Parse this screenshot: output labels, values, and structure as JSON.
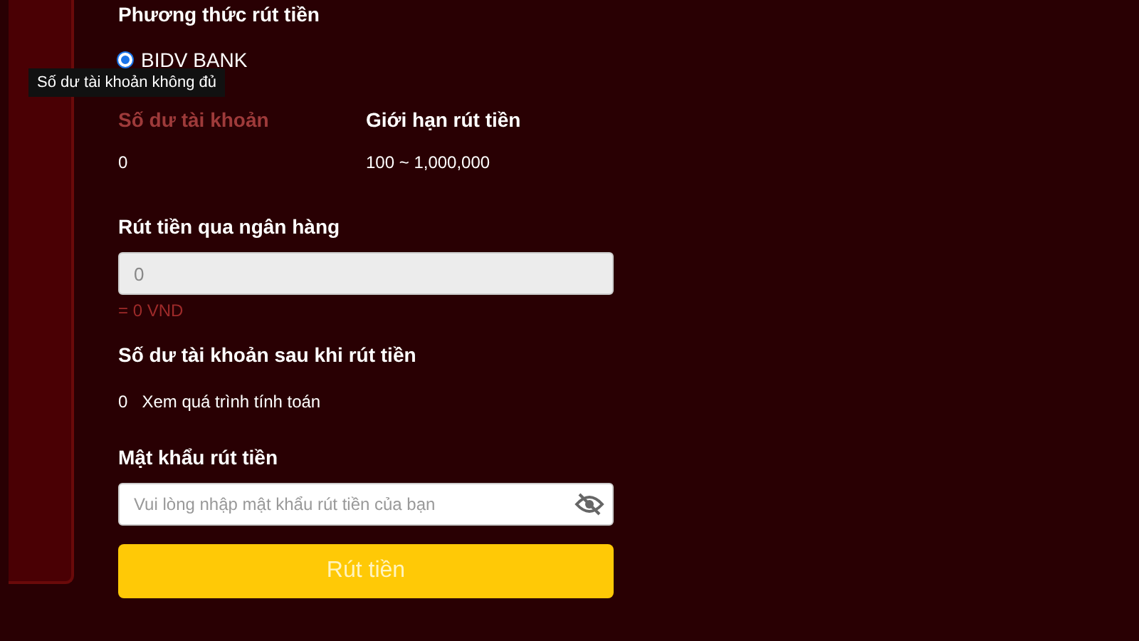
{
  "withdraw_method": {
    "heading": "Phương thức rút tiền",
    "options": [
      {
        "label": "BIDV BANK",
        "selected": true
      }
    ]
  },
  "tooltip": "Số dư tài khoản không đủ",
  "info": [
    {
      "label": "Số dư tài khoản",
      "kind": "warning",
      "value": "0"
    },
    {
      "label": "Giới hạn rút tiền",
      "kind": "normal",
      "value": "100 ~ 1,000,000"
    }
  ],
  "amount": {
    "label": "Rút tiền qua ngân hàng",
    "placeholder": "0",
    "note": "= 0 VND"
  },
  "balance_after": {
    "label": "Số dư tài khoản sau khi rút tiền",
    "value": "0",
    "link": "Xem quá trình tính toán"
  },
  "password": {
    "label": "Mật khẩu rút tiền",
    "placeholder": "Vui lòng nhập mật khẩu rút tiền của bạn"
  },
  "submit": "Rút tiền"
}
